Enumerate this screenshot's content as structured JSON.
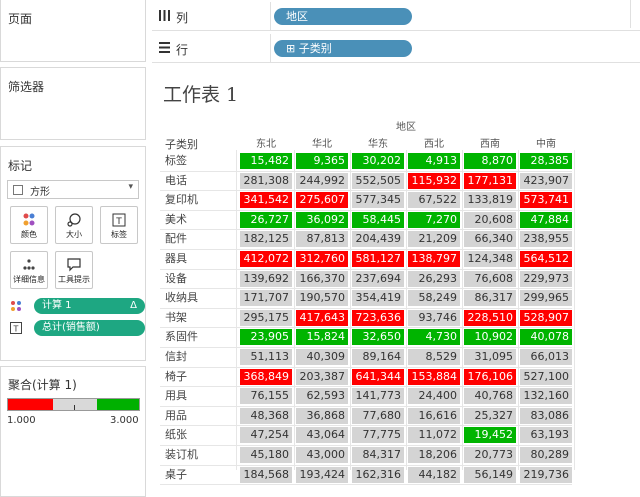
{
  "left_panel": {
    "pages_title": "页面",
    "filters_title": "筛选器",
    "marks_title": "标记",
    "mark_type": "方形",
    "mark_buttons": [
      {
        "label": "颜色",
        "icon": "color-dots-icon"
      },
      {
        "label": "大小",
        "icon": "size-icon"
      },
      {
        "label": "标签",
        "icon": "label-icon"
      },
      {
        "label": "详细信息",
        "icon": "detail-icon"
      },
      {
        "label": "工具提示",
        "icon": "tooltip-icon"
      }
    ],
    "pills": [
      {
        "label": "计算 1",
        "suffix": "Δ",
        "icon": "color-dots-icon"
      },
      {
        "label": "总计(销售额)",
        "suffix": "",
        "icon": "text-icon"
      }
    ],
    "legend": {
      "title": "聚合(计算 1)",
      "min": "1.000",
      "max": "3.000",
      "colors": [
        "#ff0000",
        "#d9d9d9",
        "#00b000"
      ]
    }
  },
  "shelves": {
    "columns": {
      "label": "列",
      "pill": "地区"
    },
    "rows": {
      "label": "行",
      "pill": "⊞ 子类别"
    }
  },
  "sheet": {
    "title": "工作表 1",
    "region_label": "地区",
    "row_header_label": "子类别",
    "columns": [
      "东北",
      "华北",
      "华东",
      "西北",
      "西南",
      "中南"
    ],
    "colors": {
      "red": "#ff0000",
      "gray": "#d4d4d4",
      "green": "#00b400"
    },
    "rows": [
      {
        "name": "标签",
        "values": [
          "15,482",
          "9,365",
          "30,202",
          "4,913",
          "8,870",
          "28,385"
        ],
        "color": [
          "green",
          "green",
          "green",
          "green",
          "green",
          "green"
        ]
      },
      {
        "name": "电话",
        "values": [
          "281,308",
          "244,992",
          "552,505",
          "115,932",
          "177,131",
          "423,907"
        ],
        "color": [
          "gray",
          "gray",
          "gray",
          "red",
          "red",
          "gray"
        ]
      },
      {
        "name": "复印机",
        "values": [
          "341,542",
          "275,607",
          "577,345",
          "67,522",
          "133,819",
          "573,741"
        ],
        "color": [
          "red",
          "red",
          "gray",
          "gray",
          "gray",
          "red"
        ]
      },
      {
        "name": "美术",
        "values": [
          "26,727",
          "36,092",
          "58,445",
          "7,270",
          "20,608",
          "47,884"
        ],
        "color": [
          "green",
          "green",
          "green",
          "green",
          "gray",
          "green"
        ]
      },
      {
        "name": "配件",
        "values": [
          "182,125",
          "87,813",
          "204,439",
          "21,209",
          "66,340",
          "238,955"
        ],
        "color": [
          "gray",
          "gray",
          "gray",
          "gray",
          "gray",
          "gray"
        ]
      },
      {
        "name": "器具",
        "values": [
          "412,072",
          "312,760",
          "581,127",
          "138,797",
          "124,348",
          "564,512"
        ],
        "color": [
          "red",
          "red",
          "red",
          "red",
          "gray",
          "red"
        ]
      },
      {
        "name": "设备",
        "values": [
          "139,692",
          "166,370",
          "237,694",
          "26,293",
          "76,608",
          "229,973"
        ],
        "color": [
          "gray",
          "gray",
          "gray",
          "gray",
          "gray",
          "gray"
        ]
      },
      {
        "name": "收纳具",
        "values": [
          "171,707",
          "190,570",
          "354,419",
          "58,249",
          "86,317",
          "299,965"
        ],
        "color": [
          "gray",
          "gray",
          "gray",
          "gray",
          "gray",
          "gray"
        ]
      },
      {
        "name": "书架",
        "values": [
          "295,175",
          "417,643",
          "723,636",
          "93,746",
          "228,510",
          "528,907"
        ],
        "color": [
          "gray",
          "red",
          "red",
          "gray",
          "red",
          "red"
        ]
      },
      {
        "name": "系固件",
        "values": [
          "23,905",
          "15,824",
          "32,650",
          "4,730",
          "10,902",
          "40,078"
        ],
        "color": [
          "green",
          "green",
          "green",
          "green",
          "green",
          "green"
        ]
      },
      {
        "name": "信封",
        "values": [
          "51,113",
          "40,309",
          "89,164",
          "8,529",
          "31,095",
          "66,013"
        ],
        "color": [
          "gray",
          "gray",
          "gray",
          "gray",
          "gray",
          "gray"
        ]
      },
      {
        "name": "椅子",
        "values": [
          "368,849",
          "203,387",
          "641,344",
          "153,884",
          "176,106",
          "527,100"
        ],
        "color": [
          "red",
          "gray",
          "red",
          "red",
          "red",
          "gray"
        ]
      },
      {
        "name": "用具",
        "values": [
          "76,155",
          "62,593",
          "141,773",
          "24,400",
          "40,768",
          "132,160"
        ],
        "color": [
          "gray",
          "gray",
          "gray",
          "gray",
          "gray",
          "gray"
        ]
      },
      {
        "name": "用品",
        "values": [
          "48,368",
          "36,868",
          "77,680",
          "16,616",
          "25,327",
          "83,086"
        ],
        "color": [
          "gray",
          "gray",
          "gray",
          "gray",
          "gray",
          "gray"
        ]
      },
      {
        "name": "纸张",
        "values": [
          "47,254",
          "43,064",
          "77,775",
          "11,072",
          "19,452",
          "63,193"
        ],
        "color": [
          "gray",
          "gray",
          "gray",
          "gray",
          "green",
          "gray"
        ]
      },
      {
        "name": "装订机",
        "values": [
          "45,180",
          "43,000",
          "84,317",
          "18,206",
          "20,773",
          "80,289"
        ],
        "color": [
          "gray",
          "gray",
          "gray",
          "gray",
          "gray",
          "gray"
        ]
      },
      {
        "name": "桌子",
        "values": [
          "184,568",
          "193,424",
          "162,316",
          "44,182",
          "56,149",
          "219,736"
        ],
        "color": [
          "gray",
          "gray",
          "gray",
          "gray",
          "gray",
          "gray"
        ]
      }
    ]
  }
}
